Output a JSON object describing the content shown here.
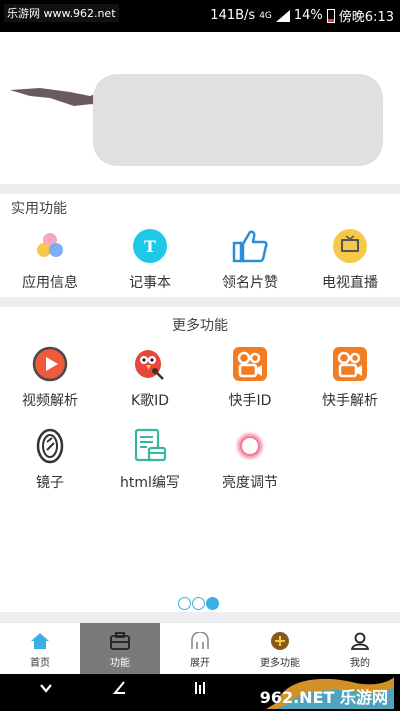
{
  "status_bar": {
    "watermark": "乐游网 www.962.net",
    "network_speed": "141B/s",
    "network_type": "4G",
    "battery": "14%",
    "time": "傍晚6:13"
  },
  "utility_section": {
    "title": "实用功能",
    "items": [
      {
        "label": "应用信息",
        "icon": "app-info-icon"
      },
      {
        "label": "记事本",
        "icon": "notepad-icon"
      },
      {
        "label": "领名片赞",
        "icon": "thumbs-up-icon"
      },
      {
        "label": "电视直播",
        "icon": "tv-icon"
      }
    ]
  },
  "more_section": {
    "title": "更多功能",
    "items": [
      {
        "label": "视频解析",
        "icon": "play-icon"
      },
      {
        "label": "K歌ID",
        "icon": "karaoke-icon"
      },
      {
        "label": "快手ID",
        "icon": "kuaishou-icon"
      },
      {
        "label": "快手解析",
        "icon": "kuaishou-icon"
      },
      {
        "label": "镜子",
        "icon": "mirror-icon"
      },
      {
        "label": "html编写",
        "icon": "html-editor-icon"
      },
      {
        "label": "亮度调节",
        "icon": "brightness-icon"
      }
    ]
  },
  "bottom_nav": {
    "items": [
      {
        "label": "首页",
        "icon": "home-icon"
      },
      {
        "label": "功能",
        "icon": "toolbox-icon"
      },
      {
        "label": "展开",
        "icon": "expand-icon"
      },
      {
        "label": "更多功能",
        "icon": "more-icon"
      },
      {
        "label": "我的",
        "icon": "profile-icon"
      }
    ],
    "active_index": 1
  },
  "pager": {
    "pages": 3,
    "active": 3
  },
  "watermark_bottom": "962.NET 乐游网",
  "colors": {
    "accent": "#3ab0e2",
    "kuaishou": "#f47c20",
    "notepad": "#1ec8e8",
    "divider": "#eeeef2"
  }
}
